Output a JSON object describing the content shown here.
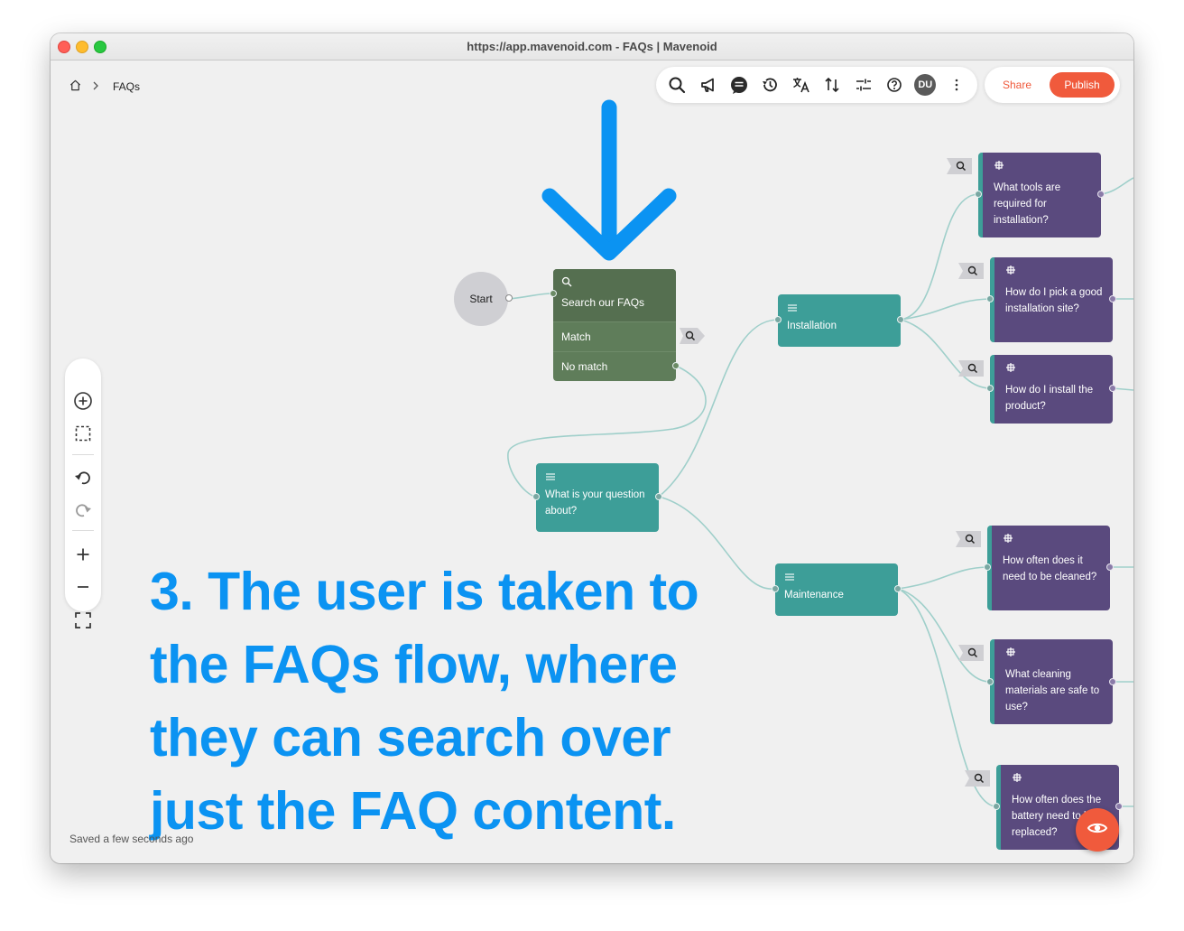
{
  "window": {
    "title": "https://app.mavenoid.com - FAQs | Mavenoid"
  },
  "breadcrumb": {
    "current": "FAQs"
  },
  "toolbar": {
    "icons": [
      "search-icon",
      "megaphone-icon",
      "chat-icon",
      "history-icon",
      "translate-icon",
      "sort-icon",
      "sliders-icon",
      "help-icon"
    ],
    "avatar_initials": "DU"
  },
  "actions": {
    "share_label": "Share",
    "publish_label": "Publish"
  },
  "flow": {
    "start_label": "Start",
    "search_node": {
      "title": "Search our FAQs",
      "branches": [
        "Match",
        "No match"
      ]
    },
    "question_node": {
      "label": "What is your question about?"
    },
    "categories": [
      {
        "label": "Installation"
      },
      {
        "label": "Maintenance"
      }
    ],
    "articles": [
      {
        "label": "What tools are required for installation?"
      },
      {
        "label": "How do I pick a good installation site?"
      },
      {
        "label": "How do I install the product?"
      },
      {
        "label": "How often does it need to be cleaned?"
      },
      {
        "label": "What cleaning materials are safe to use?"
      },
      {
        "label": "How often does the battery need to be replaced?"
      }
    ]
  },
  "annotation": {
    "text": "3. The user is taken to the FAQs flow, where they can search over just the FAQ content."
  },
  "status": {
    "saved": "Saved a few seconds ago"
  },
  "colors": {
    "accent": "#f05a3c",
    "annotation": "#0b93f2",
    "teal": "#3d9e98",
    "purple": "#5a4a7e",
    "search_green": "#5f7d5a"
  }
}
